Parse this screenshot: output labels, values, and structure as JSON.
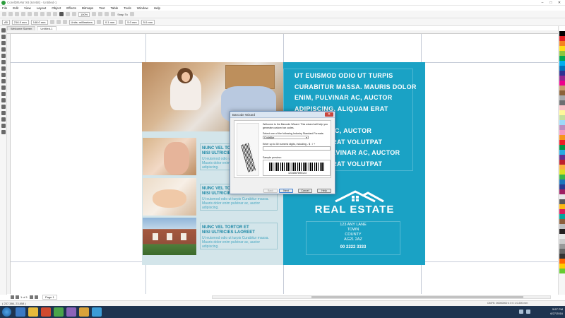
{
  "window": {
    "title": "CorelDRAW X8 (64-Bit) - Untitled-1",
    "minimize": "–",
    "maximize": "□",
    "close": "✕"
  },
  "menu": [
    "File",
    "Edit",
    "View",
    "Layout",
    "Object",
    "Effects",
    "Bitmaps",
    "Text",
    "Table",
    "Tools",
    "Window",
    "Help"
  ],
  "toolbar": {
    "zoom": "100%",
    "snap_to": "Snap To",
    "width": "216.0 mm",
    "height": "148.0 mm",
    "units": "Units: millimeters",
    "nudge": "0.1 mm",
    "dup_x": "5.0 mm",
    "dup_y": "5.0 mm",
    "page_size": "A5"
  },
  "tabs": [
    "Welcome Screen",
    "Untitled-1"
  ],
  "page_nav": {
    "page_label": "Page 1",
    "count": "1 of 1"
  },
  "design": {
    "headline": "UT EUISMOD ODIO UT TURPIS\nCURABITUR MASSA. MAURIS DOLOR\nENIM, PULVINAR AC, AUCTOR\nADIPISCING, ALIQUAM ERAT VOLUTPAT\nPULVINAR AC, AUCTOR\nALIQUAM ERAT VOLUTPAT\nMAURIS PULVINAR AC, AUCTOR\nALIQUAM ERAT VOLUTPAT\nRITIS.",
    "features": [
      {
        "title": "NUNC VEL TORTOR ET\nNISI ULTRICIES LAOREET",
        "body": "Ut euismod odio ut turpis Curabitur massa.\nMauris dolor enim pulvinar ac, auctor\nadipiscing."
      },
      {
        "title": "NUNC VEL TORTOR ET\nNISI ULTRICIES LAOREET",
        "body": "Ut euismod odio ut turpis Curabitur massa.\nMauris dolor enim pulvinar ac, auctor\nadipiscing."
      },
      {
        "title": "NUNC VEL TORTOR ET\nNISI ULTRICIES LAOREET",
        "body": "Ut euismod odio ut turpis Curabitur massa.\nMauris dolor enim pulvinar ac, auctor\nadipiscing."
      }
    ],
    "logo_text": "REAL ESTATE",
    "address": "123 ANY LANE\nTOWN\nCOUNTY\nAG21 2AZ",
    "phone": "00 2222 3333",
    "colors": {
      "teal": "#1aa2c5",
      "light_panel": "#d3e5ea",
      "heading": "#1b87a5"
    }
  },
  "dialog": {
    "title": "Barcode Wizard",
    "close": "✕",
    "welcome": "Welcome to the Barcode Wizard. This wizard will help you generate custom bar codes.",
    "select_label": "Select one of the following Industry Standard Formats:",
    "format": "CodaBar",
    "enter_label": "Enter up to 30 numeric digits, including - $ : / +",
    "input_value": "",
    "preview_label": "Sample preview:",
    "barcode_number": "1234567890123",
    "buttons": {
      "back": "Back",
      "next": "Next",
      "cancel": "Cancel",
      "help": "Help"
    }
  },
  "status": {
    "coords": "( 237.386, 23.858 )",
    "info": "CMYK: 00000000 4 0 0 1 0.200 mm"
  },
  "taskbar": {
    "time": "5:57 PM",
    "date": "6/27/2016"
  },
  "palette_colors": [
    "#ffffff",
    "#000000",
    "#e31e24",
    "#f58220",
    "#ffde17",
    "#8dc63f",
    "#00a651",
    "#00aeef",
    "#0072bc",
    "#2e3192",
    "#92278f",
    "#ec008c",
    "#c69c6d",
    "#8c6239",
    "#a7a9ac",
    "#6d6e71",
    "#f9c0c7",
    "#fff799",
    "#c4df9b",
    "#9dd9f8",
    "#bd8cbf",
    "#f49ac1",
    "#f7941d",
    "#ed1c24",
    "#009444",
    "#27aae1",
    "#662d91",
    "#be1e2d",
    "#fbb040",
    "#d7df23",
    "#39b54a",
    "#1c75bc",
    "#2b3990",
    "#9e1f63",
    "#e6e7e8",
    "#58595b",
    "#fdb913",
    "#da1c5c",
    "#00a79d",
    "#8b5e3c",
    "#bcbec0",
    "#231f20",
    "#e6e6e6",
    "#cccccc",
    "#999999",
    "#666666",
    "#333333",
    "#ff6600",
    "#ffcc00",
    "#66cc33"
  ]
}
